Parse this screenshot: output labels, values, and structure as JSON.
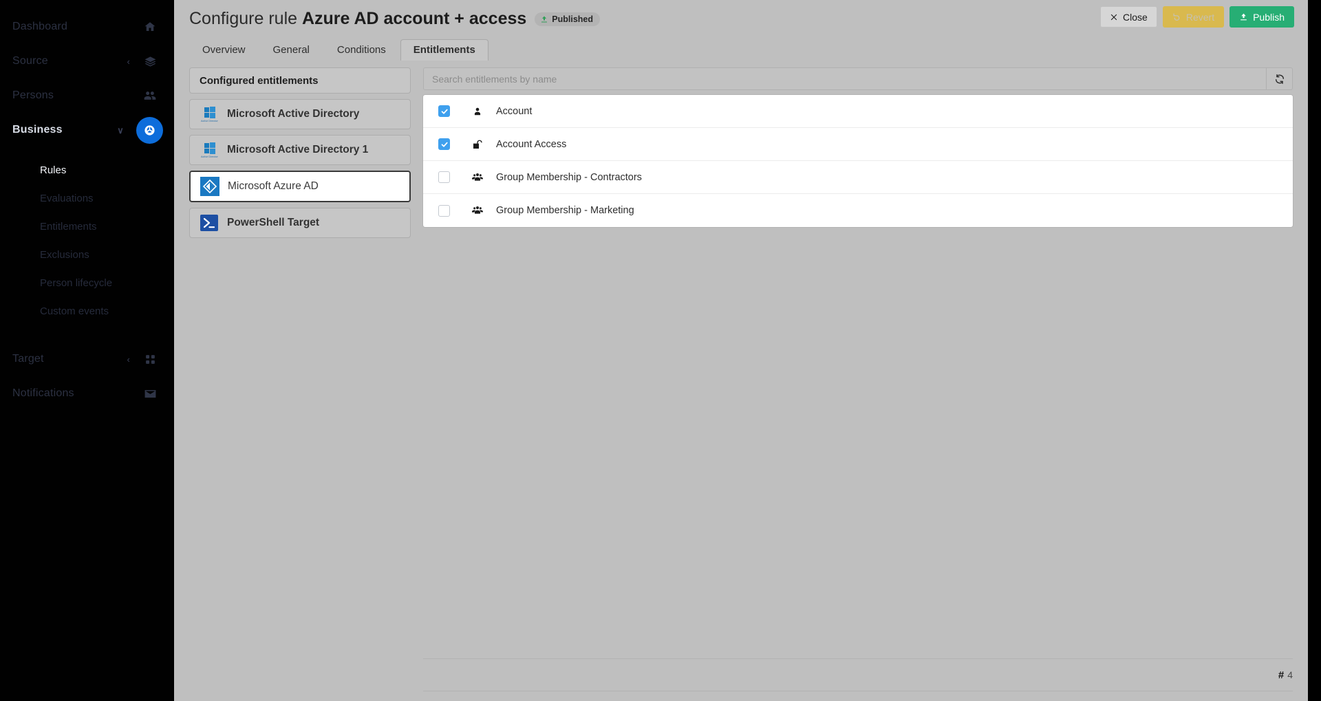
{
  "sidebar": {
    "items": [
      {
        "label": "Dashboard",
        "icon": "home-icon",
        "state": "dim",
        "caret": ""
      },
      {
        "label": "Source",
        "icon": "layers-icon",
        "state": "dim",
        "caret": "‹"
      },
      {
        "label": "Persons",
        "icon": "people-icon",
        "state": "dim",
        "caret": ""
      },
      {
        "label": "Business",
        "icon": "business-icon",
        "state": "active",
        "caret": "∨"
      }
    ],
    "sub_items": [
      {
        "label": "Rules",
        "selected": true
      },
      {
        "label": "Evaluations",
        "selected": false
      },
      {
        "label": "Entitlements",
        "selected": false
      },
      {
        "label": "Exclusions",
        "selected": false
      },
      {
        "label": "Person lifecycle",
        "selected": false
      },
      {
        "label": "Custom events",
        "selected": false
      }
    ],
    "bottom_items": [
      {
        "label": "Target",
        "icon": "grid-icon",
        "caret": "‹"
      },
      {
        "label": "Notifications",
        "icon": "envelope-icon",
        "caret": ""
      }
    ]
  },
  "header": {
    "title_prefix": "Configure rule ",
    "title_name": "Azure AD account + access",
    "badge_label": "Published",
    "badge_icon": "upload-icon",
    "buttons": {
      "close": {
        "label": "Close",
        "icon": "close-x-icon"
      },
      "revert": {
        "label": "Revert",
        "icon": "undo-icon"
      },
      "publish": {
        "label": "Publish",
        "icon": "upload-icon"
      }
    }
  },
  "tabs": [
    {
      "label": "Overview",
      "active": false
    },
    {
      "label": "General",
      "active": false
    },
    {
      "label": "Conditions",
      "active": false
    },
    {
      "label": "Entitlements",
      "active": true
    }
  ],
  "systems_panel": {
    "header_label": "Configured entitlements",
    "items": [
      {
        "label": "Microsoft Active Directory",
        "icon": "active-directory-icon",
        "selected": false
      },
      {
        "label": "Microsoft Active Directory 1",
        "icon": "active-directory-icon",
        "selected": false
      },
      {
        "label": "Microsoft Azure AD",
        "icon": "azure-ad-icon",
        "selected": true
      },
      {
        "label": "PowerShell Target",
        "icon": "powershell-icon",
        "selected": false
      }
    ]
  },
  "search": {
    "placeholder": "Search entitlements by name",
    "value": "",
    "refresh_icon": "refresh-icon"
  },
  "entitlements": [
    {
      "name": "Account",
      "icon": "person-icon",
      "checked": true
    },
    {
      "name": "Account Access",
      "icon": "unlock-icon",
      "checked": true
    },
    {
      "name": "Group Membership - Contractors",
      "icon": "group-icon",
      "checked": false
    },
    {
      "name": "Group Membership - Marketing",
      "icon": "group-icon",
      "checked": false
    }
  ],
  "footer": {
    "count_symbol": "#",
    "count_value": "4"
  },
  "colors": {
    "accent_blue": "#0d6ddb",
    "checkbox_blue": "#3fa0ee",
    "publish_green": "#27ae74",
    "revert_gold": "#d9b94e",
    "badge_green": "#2e9e57",
    "modal_bg": "#bfbfbf",
    "sidebar_bg": "#010101"
  }
}
